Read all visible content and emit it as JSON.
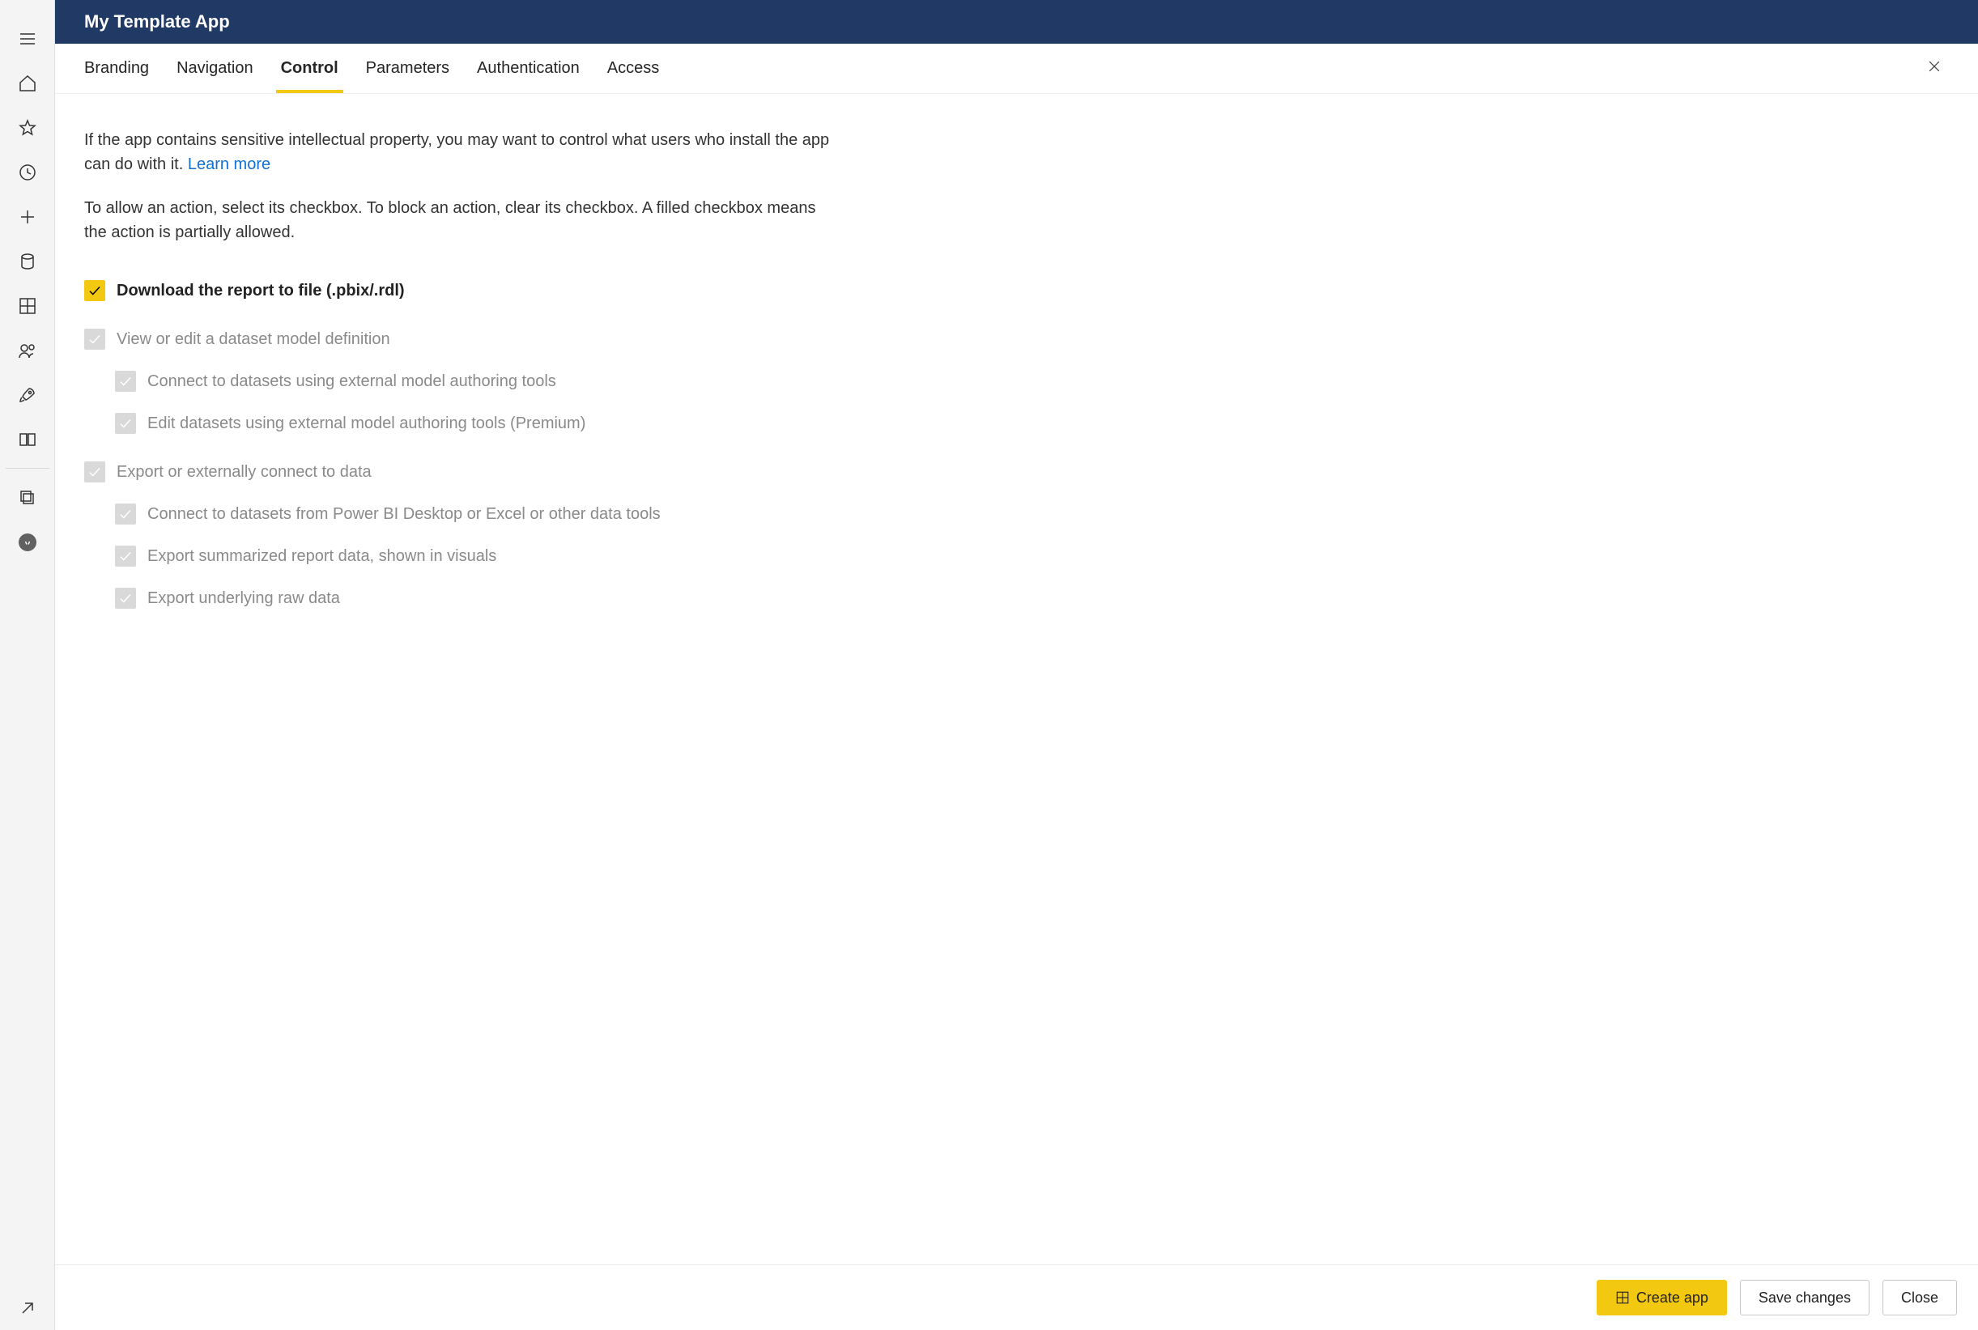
{
  "header": {
    "title": "My Template App"
  },
  "tabs": [
    {
      "label": "Branding"
    },
    {
      "label": "Navigation"
    },
    {
      "label": "Control"
    },
    {
      "label": "Parameters"
    },
    {
      "label": "Authentication"
    },
    {
      "label": "Access"
    }
  ],
  "active_tab_index": 2,
  "intro": {
    "text": "If the app contains sensitive intellectual property, you may want to control what users who install the app can do with it. ",
    "link": "Learn more"
  },
  "subintro": "To allow an action, select its checkbox. To block an action, clear its checkbox. A filled checkbox means the action is partially allowed.",
  "controls": [
    {
      "label": "Download the report to file (.pbix/.rdl)",
      "checked": true,
      "enabled": true,
      "indent": 1
    },
    {
      "label": "View or edit a dataset model definition",
      "checked": true,
      "enabled": false,
      "indent": 1,
      "groupstart": true
    },
    {
      "label": "Connect to datasets using external model authoring tools",
      "checked": true,
      "enabled": false,
      "indent": 2
    },
    {
      "label": "Edit datasets using external model authoring tools (Premium)",
      "checked": true,
      "enabled": false,
      "indent": 2
    },
    {
      "label": "Export or externally connect to data",
      "checked": true,
      "enabled": false,
      "indent": 1,
      "groupstart": true
    },
    {
      "label": "Connect to datasets from Power BI Desktop or Excel or other data tools",
      "checked": true,
      "enabled": false,
      "indent": 2
    },
    {
      "label": "Export summarized report data, shown in visuals",
      "checked": true,
      "enabled": false,
      "indent": 2
    },
    {
      "label": "Export underlying raw data",
      "checked": true,
      "enabled": false,
      "indent": 2
    }
  ],
  "footer": {
    "create": "Create app",
    "save": "Save changes",
    "close": "Close"
  },
  "rail_icons": [
    "menu",
    "home",
    "star",
    "recent",
    "plus",
    "data",
    "apps",
    "people",
    "rocket",
    "book",
    "_divider",
    "copy",
    "share-circle",
    "_spacer",
    "popout"
  ]
}
